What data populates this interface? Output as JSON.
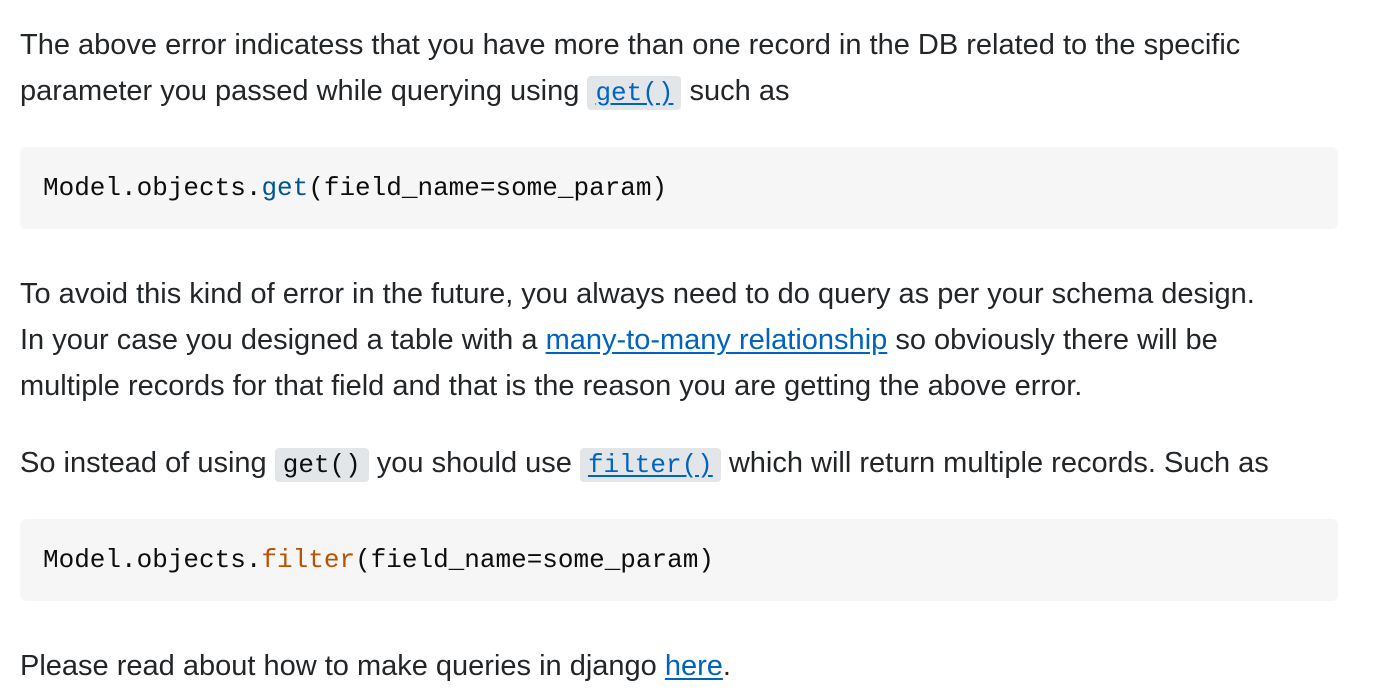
{
  "p1": {
    "line1": "The above error indicatess that you have more than one record in the DB related to the specific",
    "line2_before": "parameter you passed while querying using ",
    "get_code": "get()",
    "line2_after": " such as"
  },
  "code1": {
    "prefix": "Model.objects.",
    "method": "get",
    "args": "(field_name=some_param)"
  },
  "p2": {
    "line1": "To avoid this kind of error in the future, you always need to do query as per your schema design.",
    "line2_before": "In your case you designed a table with a ",
    "link": "many-to-many relationship",
    "line2_after": " so obviously there will be",
    "line3": "multiple records for that field and that is the reason you are getting the above error."
  },
  "p3": {
    "before": "So instead of using ",
    "get_code": "get()",
    "middle": " you should use ",
    "filter_code": "filter()",
    "after": " which will return multiple records. Such as"
  },
  "code2": {
    "prefix": "Model.objects.",
    "method": "filter",
    "args": "(field_name=some_param)"
  },
  "p4": {
    "before": "Please read about how to make queries in django ",
    "link": "here",
    "after": "."
  },
  "colors": {
    "text": "#232629",
    "link": "#0063bf",
    "code_bg": "#f6f6f6",
    "inline_code_bg": "#e3e6e8",
    "method_get": "#015692",
    "method_filter": "#b75301"
  }
}
